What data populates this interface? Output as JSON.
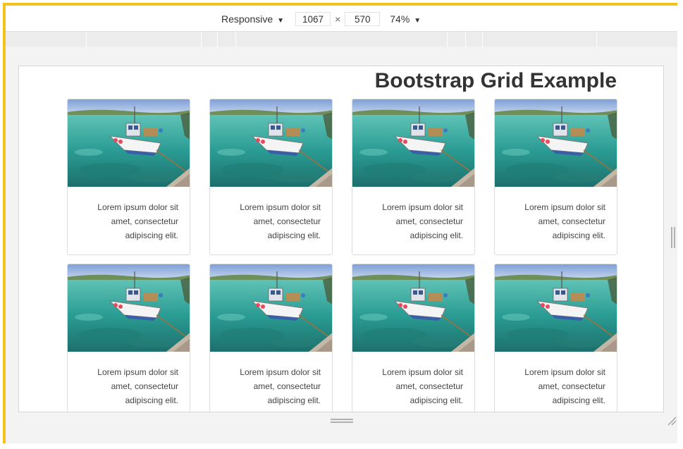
{
  "toolbar": {
    "device_label": "Responsive",
    "width_value": "1067",
    "times_symbol": "×",
    "height_value": "570",
    "zoom_label": "74%"
  },
  "page": {
    "title": "Bootstrap Grid Example"
  },
  "cards": [
    {
      "text": "Lorem ipsum dolor sit amet, consectetur adipiscing elit."
    },
    {
      "text": "Lorem ipsum dolor sit amet, consectetur adipiscing elit."
    },
    {
      "text": "Lorem ipsum dolor sit amet, consectetur adipiscing elit."
    },
    {
      "text": "Lorem ipsum dolor sit amet, consectetur adipiscing elit."
    },
    {
      "text": "Lorem ipsum dolor sit amet, consectetur adipiscing elit."
    },
    {
      "text": "Lorem ipsum dolor sit amet, consectetur adipiscing elit."
    },
    {
      "text": "Lorem ipsum dolor sit amet, consectetur adipiscing elit."
    },
    {
      "text": "Lorem ipsum dolor sit amet, consectetur adipiscing elit."
    }
  ],
  "icons": {
    "device_dropdown": "caret-down-icon",
    "zoom_dropdown": "caret-down-icon",
    "card_image": "boat-photo"
  },
  "colors": {
    "highlight_border": "#f5c21b",
    "sea": "#2fa39a",
    "sky": "#8fb3df"
  }
}
